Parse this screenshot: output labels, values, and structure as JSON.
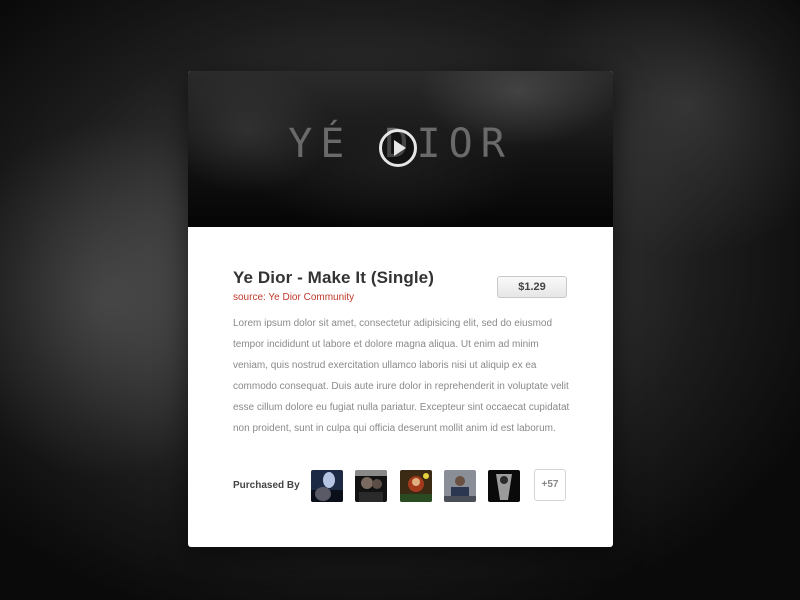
{
  "hero": {
    "logo_text": "YÉ DIOR",
    "play_icon": "play-icon"
  },
  "product": {
    "title": "Ye Dior - Make It (Single)",
    "source": "source: Ye Dior Community",
    "price": "$1.29",
    "description": "Lorem ipsum dolor sit amet, consectetur adipisicing elit, sed do eiusmod tempor incididunt ut labore et dolore magna aliqua. Ut enim ad minim veniam, quis nostrud exercitation ullamco laboris nisi ut aliquip ex ea commodo consequat. Duis aute irure dolor in reprehenderit in voluptate velit esse cillum dolore eu fugiat nulla pariatur. Excepteur sint occaecat cupidatat non proident, sunt in culpa qui officia deserunt mollit anim id est laborum."
  },
  "purchased": {
    "label": "Purchased By",
    "more_count": "+57"
  },
  "colors": {
    "source_accent": "#c0392b",
    "text_body": "#8a8a8a",
    "title": "#333333"
  }
}
